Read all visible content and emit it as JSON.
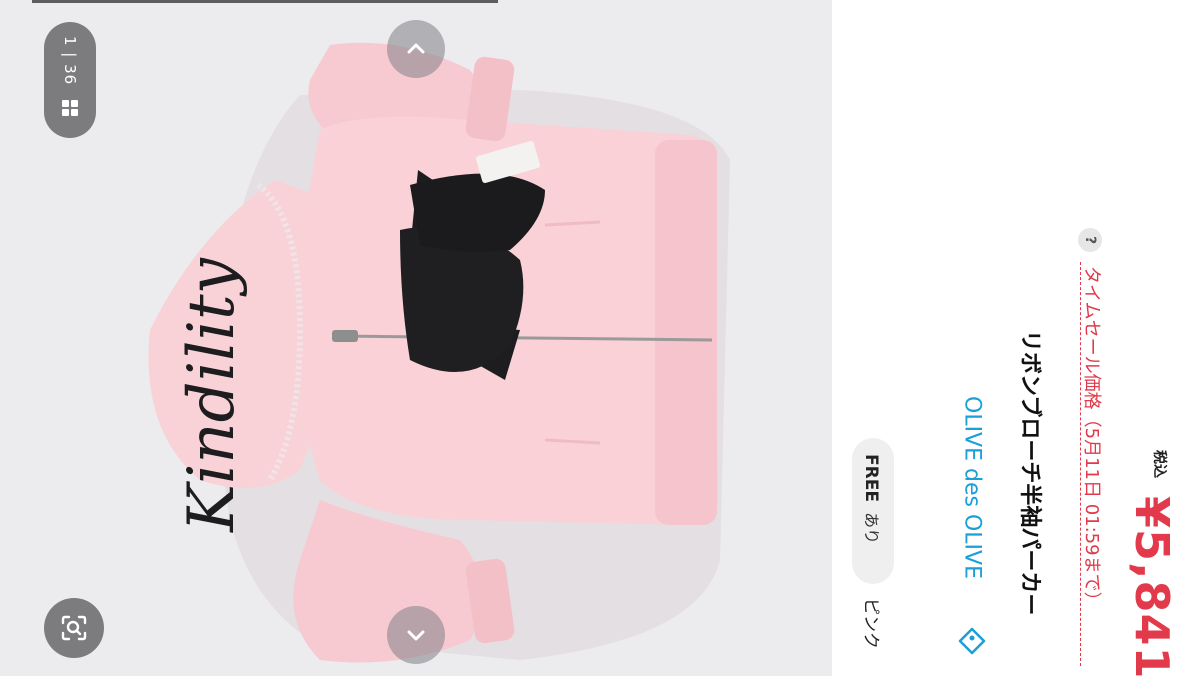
{
  "viewer": {
    "counter": "1 | 36",
    "grid_icon": "grid-icon",
    "up_icon": "chevron-up-icon",
    "down_icon": "chevron-down-icon",
    "lens_icon": "lens-search-icon",
    "print_text": "Kindility"
  },
  "product": {
    "color": "ピンク",
    "size": "FREE",
    "stock": "あり",
    "brand": "OLIVE des OLIVE",
    "name": "リボンブローチ半袖パーカー",
    "sale_label": "タイムセール価格（5月11日 01:59まで）",
    "help_mark": "?",
    "price": "¥5,841",
    "tax_label": "税込"
  },
  "colors": {
    "accent_red": "#e23a4b",
    "brand_blue": "#1a9fd6",
    "garment_pink": "#f8cdd3"
  }
}
